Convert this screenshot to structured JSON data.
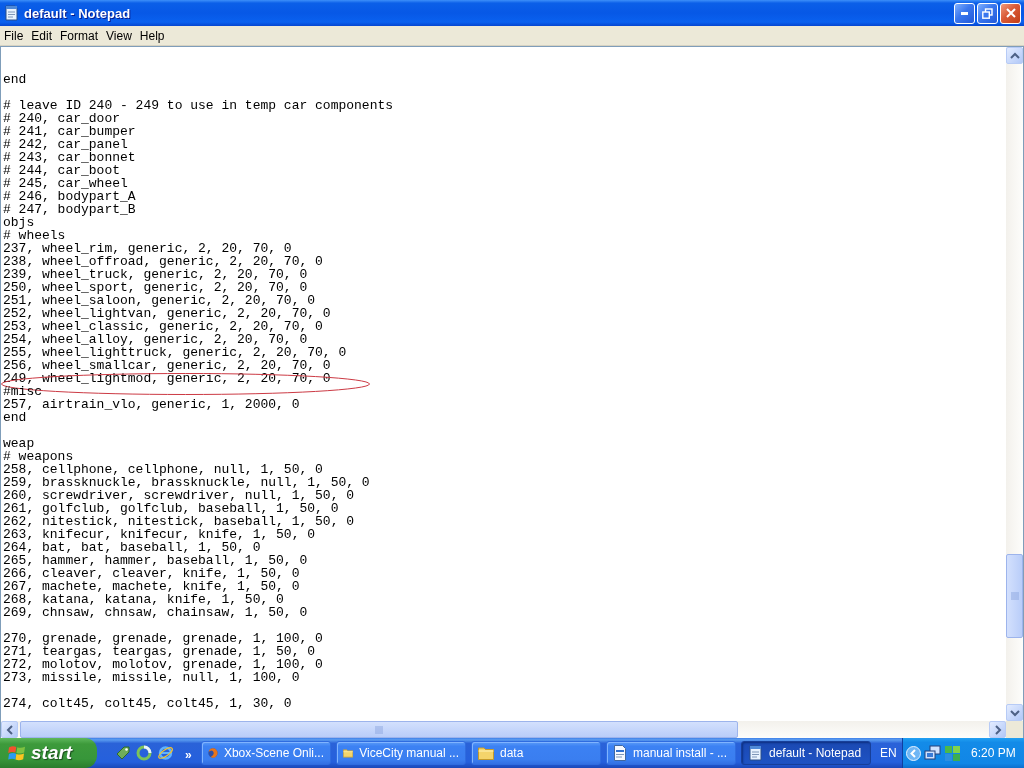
{
  "window": {
    "title": "default - Notepad"
  },
  "menu": [
    {
      "label": "File"
    },
    {
      "label": "Edit"
    },
    {
      "label": "Format"
    },
    {
      "label": "View"
    },
    {
      "label": "Help"
    }
  ],
  "document": {
    "blocks": [
      {
        "lines": [
          {
            "text": "end",
            "circled": false
          }
        ]
      },
      {
        "lines": [
          {
            "text": "# leave ID 240 - 249 to use in temp car components",
            "circled": false
          },
          {
            "text": "# 240, car_door",
            "circled": false
          },
          {
            "text": "# 241, car_bumper",
            "circled": false
          },
          {
            "text": "# 242, car_panel",
            "circled": false
          },
          {
            "text": "# 243, car_bonnet",
            "circled": false
          },
          {
            "text": "# 244, car_boot",
            "circled": false
          },
          {
            "text": "# 245, car_wheel",
            "circled": false
          },
          {
            "text": "# 246, bodypart_A",
            "circled": false
          },
          {
            "text": "# 247, bodypart_B",
            "circled": false
          },
          {
            "text": "objs",
            "circled": false
          },
          {
            "text": "# wheels",
            "circled": false
          },
          {
            "text": "237, wheel_rim, generic, 2, 20, 70, 0",
            "circled": false
          },
          {
            "text": "238, wheel_offroad, generic, 2, 20, 70, 0",
            "circled": false
          },
          {
            "text": "239, wheel_truck, generic, 2, 20, 70, 0",
            "circled": false
          },
          {
            "text": "250, wheel_sport, generic, 2, 20, 70, 0",
            "circled": false
          },
          {
            "text": "251, wheel_saloon, generic, 2, 20, 70, 0",
            "circled": false
          },
          {
            "text": "252, wheel_lightvan, generic, 2, 20, 70, 0",
            "circled": false
          },
          {
            "text": "253, wheel_classic, generic, 2, 20, 70, 0",
            "circled": false
          },
          {
            "text": "254, wheel_alloy, generic, 2, 20, 70, 0",
            "circled": false
          },
          {
            "text": "255, wheel_lighttruck, generic, 2, 20, 70, 0",
            "circled": false
          },
          {
            "text": "256, wheel_smallcar, generic, 2, 20, 70, 0",
            "circled": false
          },
          {
            "text": "249, wheel_lightmod, generic, 2, 20, 70, 0",
            "circled": true
          },
          {
            "text": "#misc",
            "circled": false
          },
          {
            "text": "257, airtrain_vlo, generic, 1, 2000, 0",
            "circled": false
          },
          {
            "text": "end",
            "circled": false
          }
        ]
      },
      {
        "lines": [
          {
            "text": "weap",
            "circled": false
          },
          {
            "text": "# weapons",
            "circled": false
          },
          {
            "text": "258, cellphone, cellphone, null, 1, 50, 0",
            "circled": false
          },
          {
            "text": "259, brassknuckle, brassknuckle, null, 1, 50, 0",
            "circled": false
          },
          {
            "text": "260, screwdriver, screwdriver, null, 1, 50, 0",
            "circled": false
          },
          {
            "text": "261, golfclub, golfclub, baseball, 1, 50, 0",
            "circled": false
          },
          {
            "text": "262, nitestick, nitestick, baseball, 1, 50, 0",
            "circled": false
          },
          {
            "text": "263, knifecur, knifecur, knife, 1, 50, 0",
            "circled": false
          },
          {
            "text": "264, bat, bat, baseball, 1, 50, 0",
            "circled": false
          },
          {
            "text": "265, hammer, hammer, baseball, 1, 50, 0",
            "circled": false
          },
          {
            "text": "266, cleaver, cleaver, knife, 1, 50, 0",
            "circled": false
          },
          {
            "text": "267, machete, machete, knife, 1, 50, 0",
            "circled": false
          },
          {
            "text": "268, katana, katana, knife, 1, 50, 0",
            "circled": false
          },
          {
            "text": "269, chnsaw, chnsaw, chainsaw, 1, 50, 0",
            "circled": false
          }
        ]
      },
      {
        "lines": [
          {
            "text": "270, grenade, grenade, grenade, 1, 100, 0",
            "circled": false
          },
          {
            "text": "271, teargas, teargas, grenade, 1, 50, 0",
            "circled": false
          },
          {
            "text": "272, molotov, molotov, grenade, 1, 100, 0",
            "circled": false
          },
          {
            "text": "273, missile, missile, null, 1, 100, 0",
            "circled": false
          }
        ]
      },
      {
        "lines": [
          {
            "text": "274, colt45, colt45, colt45, 1, 30, 0",
            "circled": false
          }
        ]
      }
    ]
  },
  "taskbar": {
    "start_label": "start",
    "quick_launch_more": "»",
    "tasks": [
      {
        "label": "Xbox-Scene Onli...",
        "kind": "browser",
        "selected": false
      },
      {
        "label": "ViceCity manual ...",
        "kind": "folder",
        "selected": false
      },
      {
        "label": "data",
        "kind": "folder",
        "selected": false
      },
      {
        "label": "manual install - ...",
        "kind": "document",
        "selected": false
      },
      {
        "label": "default - Notepad",
        "kind": "notepad",
        "selected": true
      }
    ],
    "language": "EN",
    "clock": "6:20 PM"
  }
}
